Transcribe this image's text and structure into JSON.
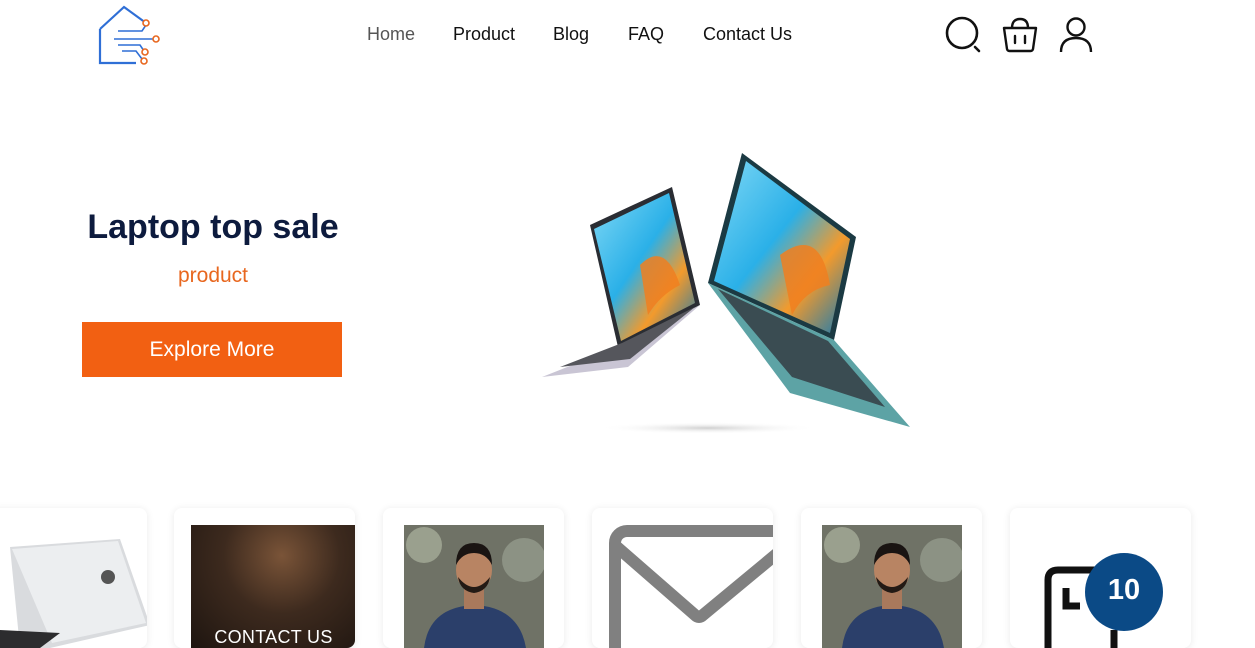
{
  "header": {
    "logo_icon": "circuit-house-logo",
    "nav": [
      "Home",
      "Product",
      "Blog",
      "FAQ",
      "Contact Us"
    ],
    "active_nav": "Home",
    "icons": [
      "search-icon",
      "basket-icon",
      "user-icon"
    ]
  },
  "hero": {
    "title": "Laptop top sale",
    "subtitle": "product",
    "button_label": "Explore More",
    "image": "laptops-pair-image"
  },
  "cards": [
    {
      "image": "silver-laptop-image"
    },
    {
      "image": "contact-us-image",
      "overlay_text": "CONTACT US"
    },
    {
      "image": "person-portrait-image"
    },
    {
      "image": "mail-envelope-icon"
    },
    {
      "image": "person-portrait-image"
    },
    {
      "image": "package-icon",
      "badge": "10"
    }
  ],
  "colors": {
    "accent": "#f26012",
    "title": "#0d1b3e",
    "subtitle": "#e8671f",
    "logo": "#2f6fd6",
    "badge": "#0b4a86"
  }
}
